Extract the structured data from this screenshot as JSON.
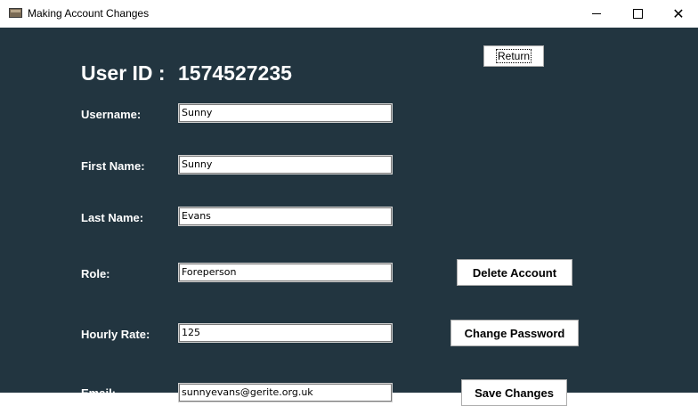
{
  "window": {
    "title": "Making Account Changes"
  },
  "user": {
    "id_label": "User ID :",
    "id_value": "1574527235"
  },
  "buttons": {
    "return_label": "Return",
    "delete_account_label": "Delete Account",
    "change_password_label": "Change Password",
    "save_changes_label": "Save Changes"
  },
  "fields": {
    "username": {
      "label": "Username:",
      "value": "Sunny"
    },
    "first_name": {
      "label": "First Name:",
      "value": "Sunny"
    },
    "last_name": {
      "label": "Last Name:",
      "value": "Evans"
    },
    "role": {
      "label": "Role:",
      "value": "Foreperson"
    },
    "hourly_rate": {
      "label": "Hourly Rate:",
      "value": "125"
    },
    "email": {
      "label": "Email:",
      "value": "sunnyevans@gerite.org.uk"
    }
  },
  "colors": {
    "background": "#223540",
    "text": "#ffffff"
  }
}
